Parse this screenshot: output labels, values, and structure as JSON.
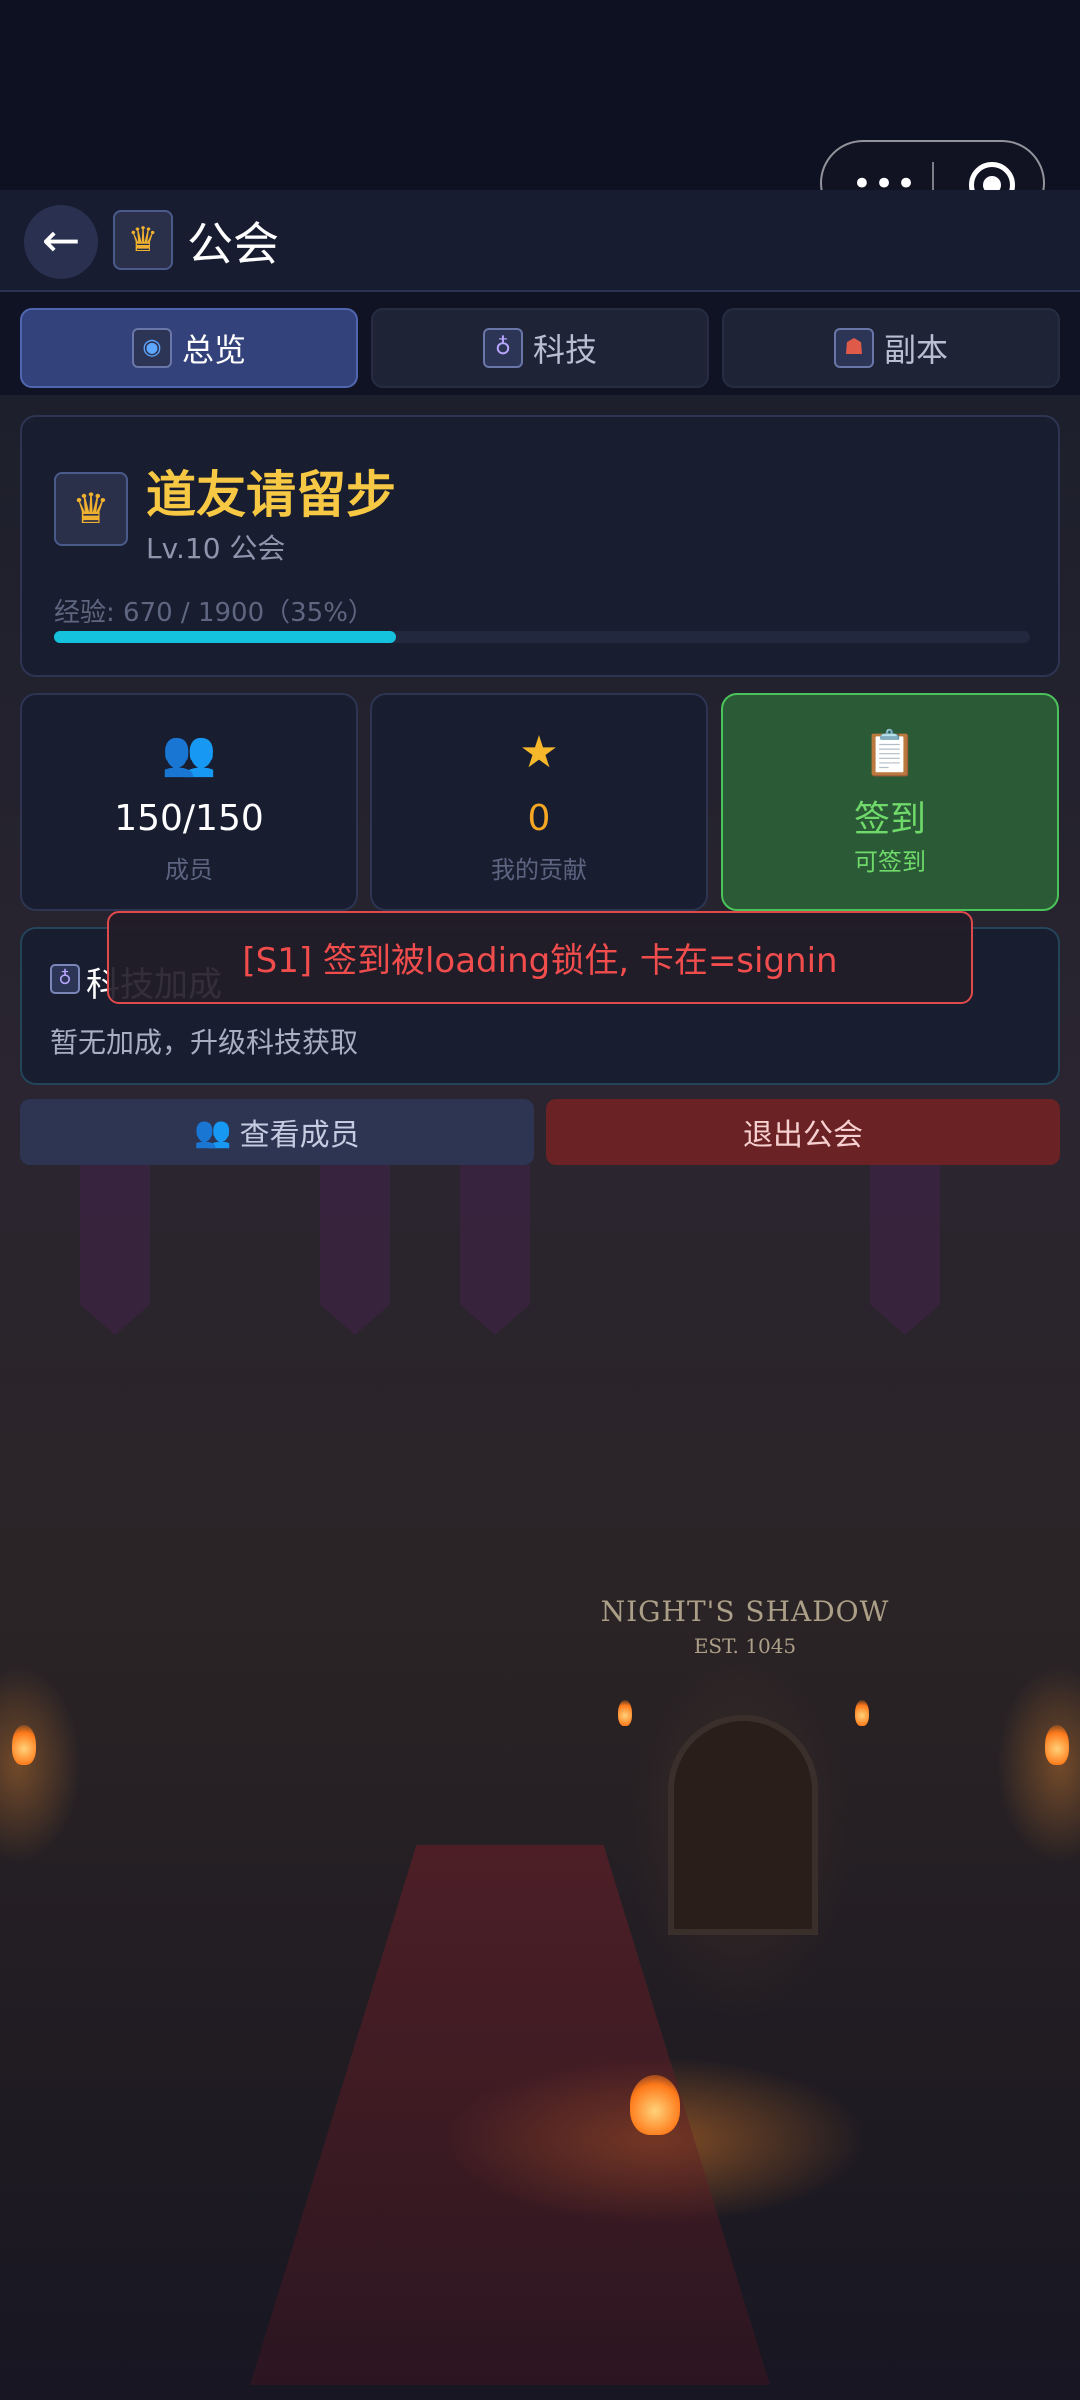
{
  "header": {
    "title": "公会",
    "back_icon": "←",
    "guild_icon": "♛"
  },
  "capsule": {
    "more": "•••"
  },
  "tabs": [
    {
      "label": "总览",
      "active": true
    },
    {
      "label": "科技",
      "active": false
    },
    {
      "label": "副本",
      "active": false
    }
  ],
  "guild": {
    "name": "道友请留步",
    "level_text": "Lv.10  公会",
    "exp_text": "经验: 670 / 1900（35%）",
    "exp_fraction": 0.35,
    "emblem": "♛"
  },
  "stats": {
    "members": {
      "value": "150/150",
      "label": "成员",
      "icon": "👥"
    },
    "contribution": {
      "value": "0",
      "label": "我的贡献",
      "icon": "★"
    },
    "signin": {
      "value": "签到",
      "label": "可签到",
      "icon": "📋"
    }
  },
  "tech_bonus": {
    "title": "科技加成",
    "description": "暂无加成，升级科技获取"
  },
  "error_toast": "[S1] 签到被loading锁住, 卡在=signin",
  "actions": {
    "view_members": "查看成员",
    "view_members_icon": "👥",
    "quit_guild": "退出公会"
  },
  "background": {
    "sign_line1": "NIGHT'S SHADOW",
    "sign_line2": "EST. 1045"
  },
  "colors": {
    "accent_gold": "#f7c843",
    "exp_bar": "#14c2de",
    "signin_green": "#6fd96a",
    "error_red": "#f24d4d"
  }
}
